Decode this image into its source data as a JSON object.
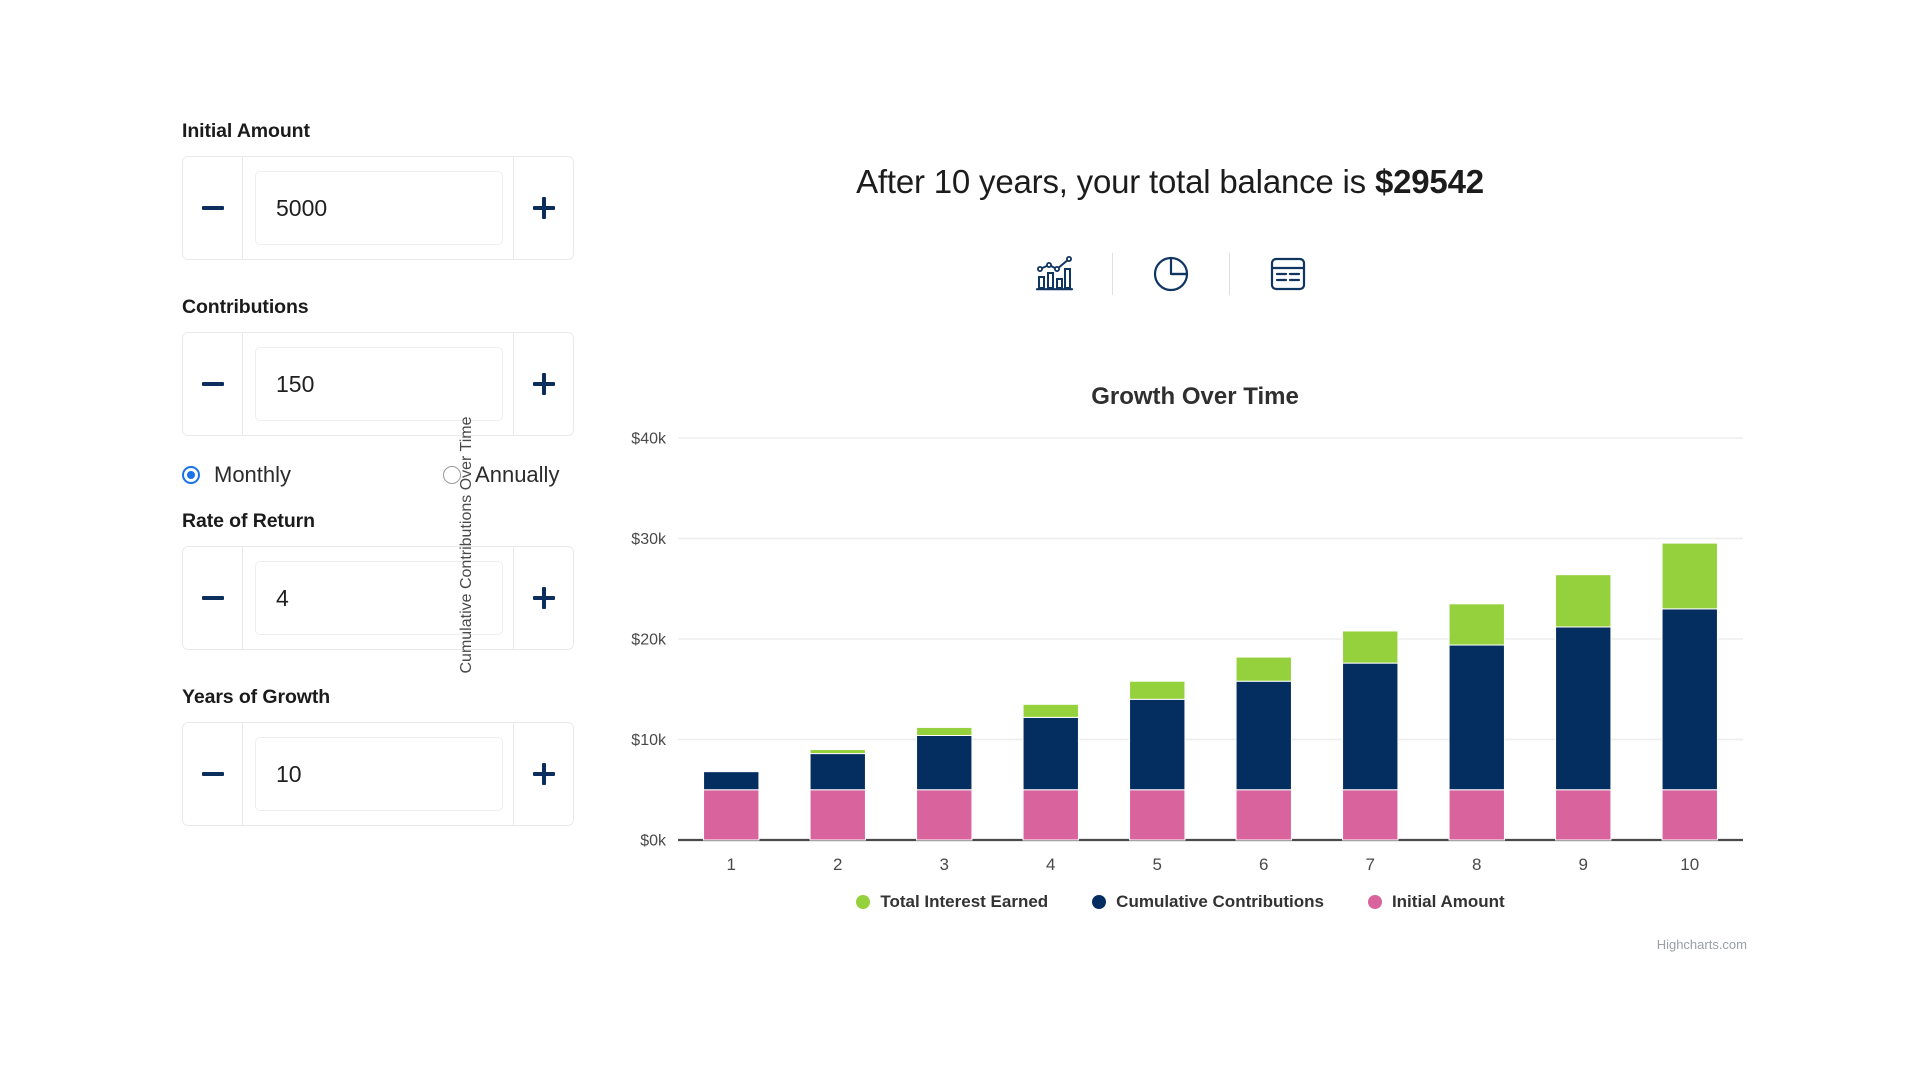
{
  "form": {
    "fields": [
      {
        "label": "Initial Amount",
        "value": "5000",
        "name": "initial-amount"
      },
      {
        "label": "Contributions",
        "value": "150",
        "name": "contributions"
      },
      {
        "label": "Rate of Return",
        "value": "4",
        "name": "rate-of-return"
      },
      {
        "label": "Years of Growth",
        "value": "10",
        "name": "years-of-growth"
      }
    ],
    "frequency": {
      "options": [
        {
          "label": "Monthly",
          "selected": true
        },
        {
          "label": "Annually",
          "selected": false
        }
      ]
    },
    "decrement_icon": "minus-icon",
    "increment_icon": "plus-icon"
  },
  "result": {
    "prefix": "After 10 years, your total balance is ",
    "amount": "$29542"
  },
  "view_toggles": [
    {
      "icon": "bar-line-chart-icon",
      "name": "chart-view-toggle"
    },
    {
      "icon": "pie-chart-icon",
      "name": "pie-view-toggle"
    },
    {
      "icon": "table-icon",
      "name": "table-view-toggle"
    }
  ],
  "credits": "Highcharts.com",
  "colors": {
    "interest": "#95d13c",
    "contributions": "#042d60",
    "initial": "#d9639d",
    "accent": "#0c2e5c",
    "radio": "#1a73e8"
  },
  "chart_data": {
    "type": "bar",
    "title": "Growth Over Time",
    "xlabel": "",
    "ylabel": "Cumulative Contributions Over Time",
    "categories": [
      "1",
      "2",
      "3",
      "4",
      "5",
      "6",
      "7",
      "8",
      "9",
      "10"
    ],
    "ylim": [
      0,
      40000
    ],
    "yticks": [
      0,
      10000,
      20000,
      30000,
      40000
    ],
    "ytick_labels": [
      "$0k",
      "$10k",
      "$20k",
      "$30k",
      "$40k"
    ],
    "grid": true,
    "stacked": true,
    "legend_position": "bottom",
    "series": [
      {
        "name": "Initial Amount",
        "color": "#d9639d",
        "values": [
          5000,
          5000,
          5000,
          5000,
          5000,
          5000,
          5000,
          5000,
          5000,
          5000
        ]
      },
      {
        "name": "Cumulative Contributions",
        "color": "#042d60",
        "values": [
          1800,
          3600,
          5400,
          7200,
          9000,
          10800,
          12600,
          14400,
          16200,
          18000
        ]
      },
      {
        "name": "Total Interest Earned",
        "color": "#95d13c",
        "values": [
          242,
          630,
          1167,
          1860,
          2718,
          3749,
          4962,
          6366,
          7971,
          9787
        ]
      }
    ],
    "totals": [
      7042,
      9230,
      11567,
      14060,
      16718,
      19549,
      22562,
      25766,
      29171,
      29542
    ],
    "bar_totals_displayed": [
      6800,
      9000,
      11200,
      13500,
      15800,
      18200,
      20800,
      23500,
      26400,
      29542
    ]
  }
}
